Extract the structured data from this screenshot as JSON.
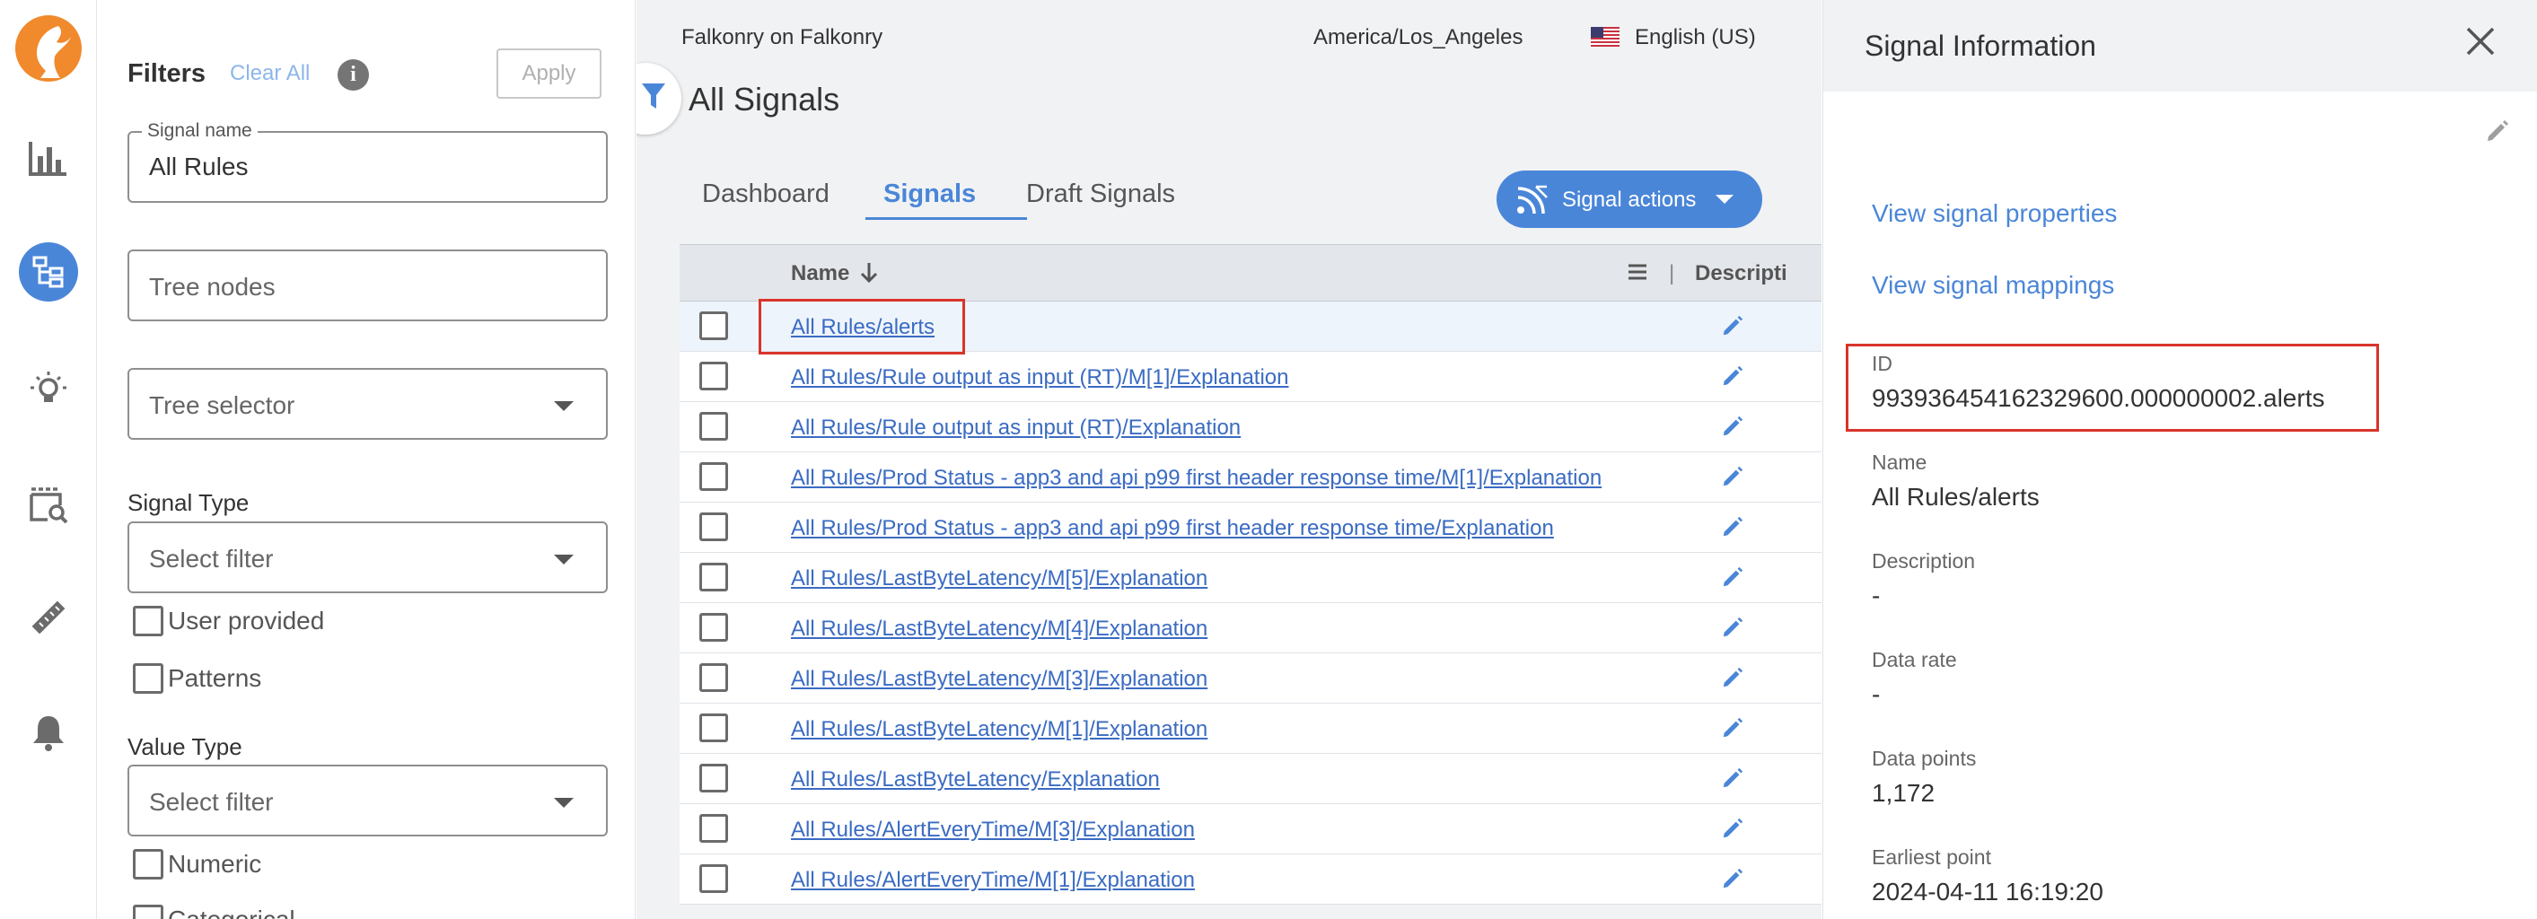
{
  "nav": {
    "icons": [
      "falkonry-logo",
      "bar-chart-icon",
      "tree-icon",
      "lightbulb-icon",
      "film-search-icon",
      "ruler-icon",
      "bell-icon"
    ]
  },
  "filters": {
    "title": "Filters",
    "clear_all": "Clear All",
    "info_glyph": "i",
    "apply": "Apply",
    "signal_name": {
      "label": "Signal name",
      "value": "All Rules"
    },
    "tree_nodes_placeholder": "Tree nodes",
    "tree_selector_placeholder": "Tree selector",
    "signal_type": {
      "label": "Signal Type",
      "placeholder": "Select filter",
      "options": [
        "User provided",
        "Patterns"
      ]
    },
    "value_type": {
      "label": "Value Type",
      "placeholder": "Select filter",
      "options": [
        "Numeric",
        "Categorical"
      ]
    }
  },
  "topbar": {
    "org": "Falkonry on Falkonry",
    "timezone": "America/Los_Angeles",
    "language": "English (US)"
  },
  "page": {
    "title": "All Signals",
    "tabs": [
      "Dashboard",
      "Signals",
      "Draft Signals"
    ],
    "active_tab": "Signals",
    "signal_actions": "Signal actions"
  },
  "table": {
    "col_name": "Name",
    "col_desc": "Descripti",
    "separator": "|",
    "rows": [
      "All Rules/alerts",
      "All Rules/Rule output as input (RT)/M[1]/Explanation",
      "All Rules/Rule output as input (RT)/Explanation",
      "All Rules/Prod Status - app3 and api p99 first header response time/M[1]/Explanation",
      "All Rules/Prod Status - app3 and api p99 first header response time/Explanation",
      "All Rules/LastByteLatency/M[5]/Explanation",
      "All Rules/LastByteLatency/M[4]/Explanation",
      "All Rules/LastByteLatency/M[3]/Explanation",
      "All Rules/LastByteLatency/M[1]/Explanation",
      "All Rules/LastByteLatency/Explanation",
      "All Rules/AlertEveryTime/M[3]/Explanation",
      "All Rules/AlertEveryTime/M[1]/Explanation"
    ]
  },
  "info": {
    "title": "Signal Information",
    "view_properties": "View signal properties",
    "view_mappings": "View signal mappings",
    "id_label": "ID",
    "id_value": "993936454162329600.000000002.alerts",
    "name_label": "Name",
    "name_value": "All Rules/alerts",
    "description_label": "Description",
    "description_value": "-",
    "data_rate_label": "Data rate",
    "data_rate_value": "-",
    "data_points_label": "Data points",
    "data_points_value": "1,172",
    "earliest_label": "Earliest point",
    "earliest_value": "2024-04-11 16:19:20"
  },
  "colors": {
    "accent": "#4a86d8",
    "brand": "#f08a2c",
    "highlight": "#d9342b"
  }
}
